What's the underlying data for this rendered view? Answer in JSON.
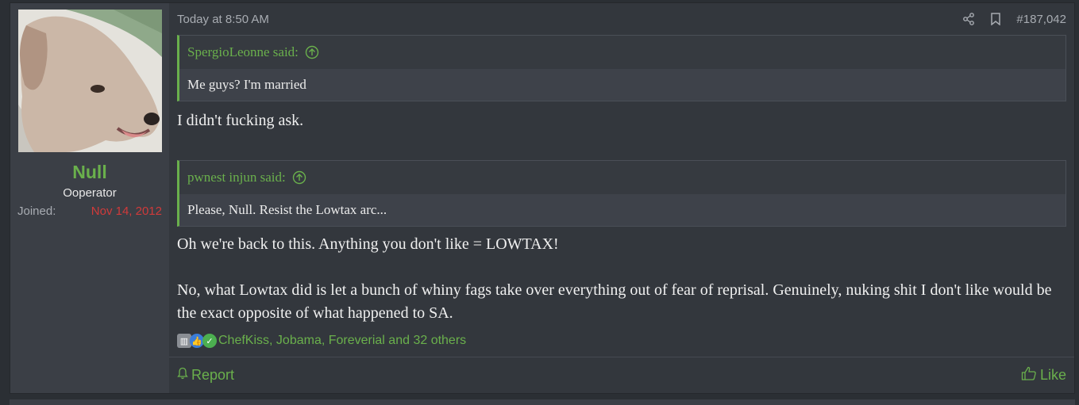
{
  "user": {
    "name": "Null",
    "title": "Ooperator",
    "joined_label": "Joined:",
    "joined_date": "Nov 14, 2012"
  },
  "post": {
    "time": "Today at 8:50 AM",
    "number": "#187,042",
    "quotes": [
      {
        "author": "SpergioLeonne said:",
        "text": "Me guys? I'm married"
      },
      {
        "author": "pwnest injun said:",
        "text": "Please, Null. Resist the Lowtax arc..."
      }
    ],
    "reply1": "I didn't fucking ask.",
    "reply2": "Oh we're back to this. Anything you don't like = LOWTAX!",
    "reply3": "No, what Lowtax did is let a bunch of whiny fags take over everything out of fear of reprisal. Genuinely, nuking shit I don't like would be the exact opposite of what happened to SA.",
    "reactions_text": "ChefKiss, Jobama, Foreverial and 32 others",
    "report_label": "Report",
    "like_label": "Like"
  },
  "colors": {
    "accent": "#6ab04c",
    "joined_date": "#d03a3a"
  }
}
